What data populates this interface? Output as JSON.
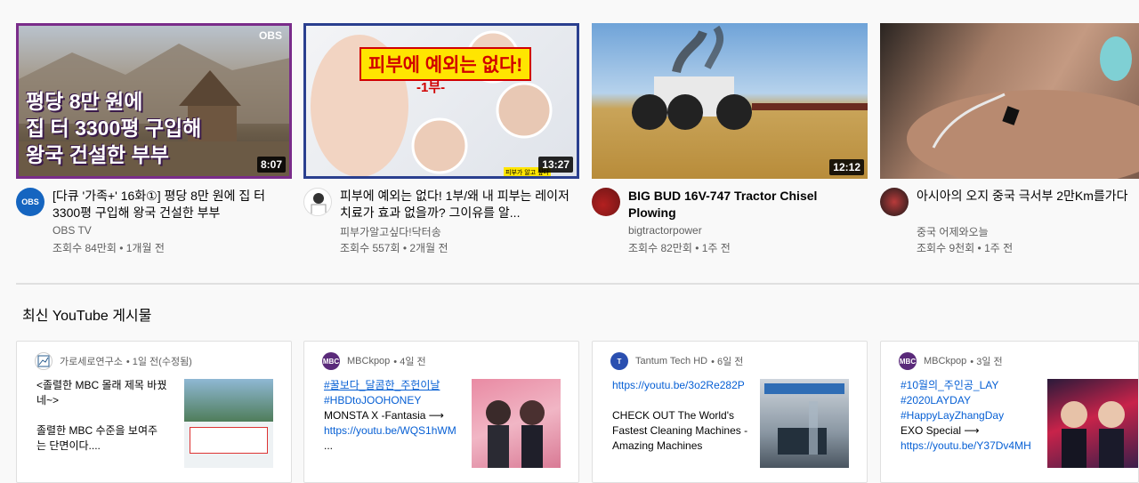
{
  "videos": [
    {
      "thumb_text": [
        "평당 8만 원에",
        "집 터 3300평 구입해",
        "왕국 건설한 부부"
      ],
      "thumb_badge": "OBS",
      "duration": "8:07",
      "title": "[다큐 '가족+' 16화①] 평당 8만 원에 집 터 3300평 구입해 왕국 건설한 부부",
      "channel": "OBS TV",
      "views": "조회수 84만회 • 1개월 전",
      "avatar_text": "OBS"
    },
    {
      "thumb_banner": "피부에 예외는 없다!",
      "thumb_sub": "-1부-",
      "thumb_corner": "피부가 알고 싶다",
      "duration": "13:27",
      "title": "피부에 예외는 없다! 1부/왜 내 피부는 레이저치료가 효과 없을까? 그이유를 알...",
      "channel": "피부가알고싶다!닥터송",
      "views": "조회수 557회 • 2개월 전"
    },
    {
      "duration": "12:12",
      "title": "BIG BUD 16V-747 Tractor Chisel Plowing",
      "channel": "bigtractorpower",
      "views": "조회수 82만회 • 1주 전"
    },
    {
      "title": "아시아의 오지 중국 극서부 2만Km를가다",
      "channel": "중국 어제와오늘",
      "views": "조회수 9천회 • 1주 전"
    }
  ],
  "section_title": "최신 YouTube 게시물",
  "posts": [
    {
      "author": "가로세로연구소",
      "time": "• 1일 전(수정됨)",
      "lines": [
        "<졸렬한 MBC 몰래 제목 바꿨",
        "네~>",
        "",
        "졸렬한 MBC 수준을 보여주",
        "는 단면이다...."
      ],
      "links": []
    },
    {
      "author": "MBCkpop",
      "time": "• 4일 전",
      "avatar_text": "MBC",
      "lines": [
        "MONSTA X -Fantasia ⟶"
      ],
      "links": [
        "#꿀보다_달콤한_주헌이날",
        "#HBDtoJOOHONEY",
        "https://youtu.be/WQS1hWM"
      ],
      "more": "..."
    },
    {
      "author": "Tantum Tech HD",
      "time": "• 6일 전",
      "avatar_text": "T",
      "links": [
        "https://youtu.be/3o2Re282P"
      ],
      "lines": [
        "CHECK OUT The World's",
        "Fastest Cleaning Machines -",
        "Amazing Machines"
      ]
    },
    {
      "author": "MBCkpop",
      "time": "• 3일 전",
      "avatar_text": "MBC",
      "links": [
        "#10월의_주인공_LAY",
        "#2020LAYDAY",
        "#HappyLayZhangDay",
        "https://youtu.be/Y37Dv4MH"
      ],
      "lines": [
        "EXO Special ⟶"
      ]
    }
  ],
  "colors": {
    "link": "#065fd4",
    "secondary_text": "#606060",
    "background": "#f9f9f9"
  }
}
